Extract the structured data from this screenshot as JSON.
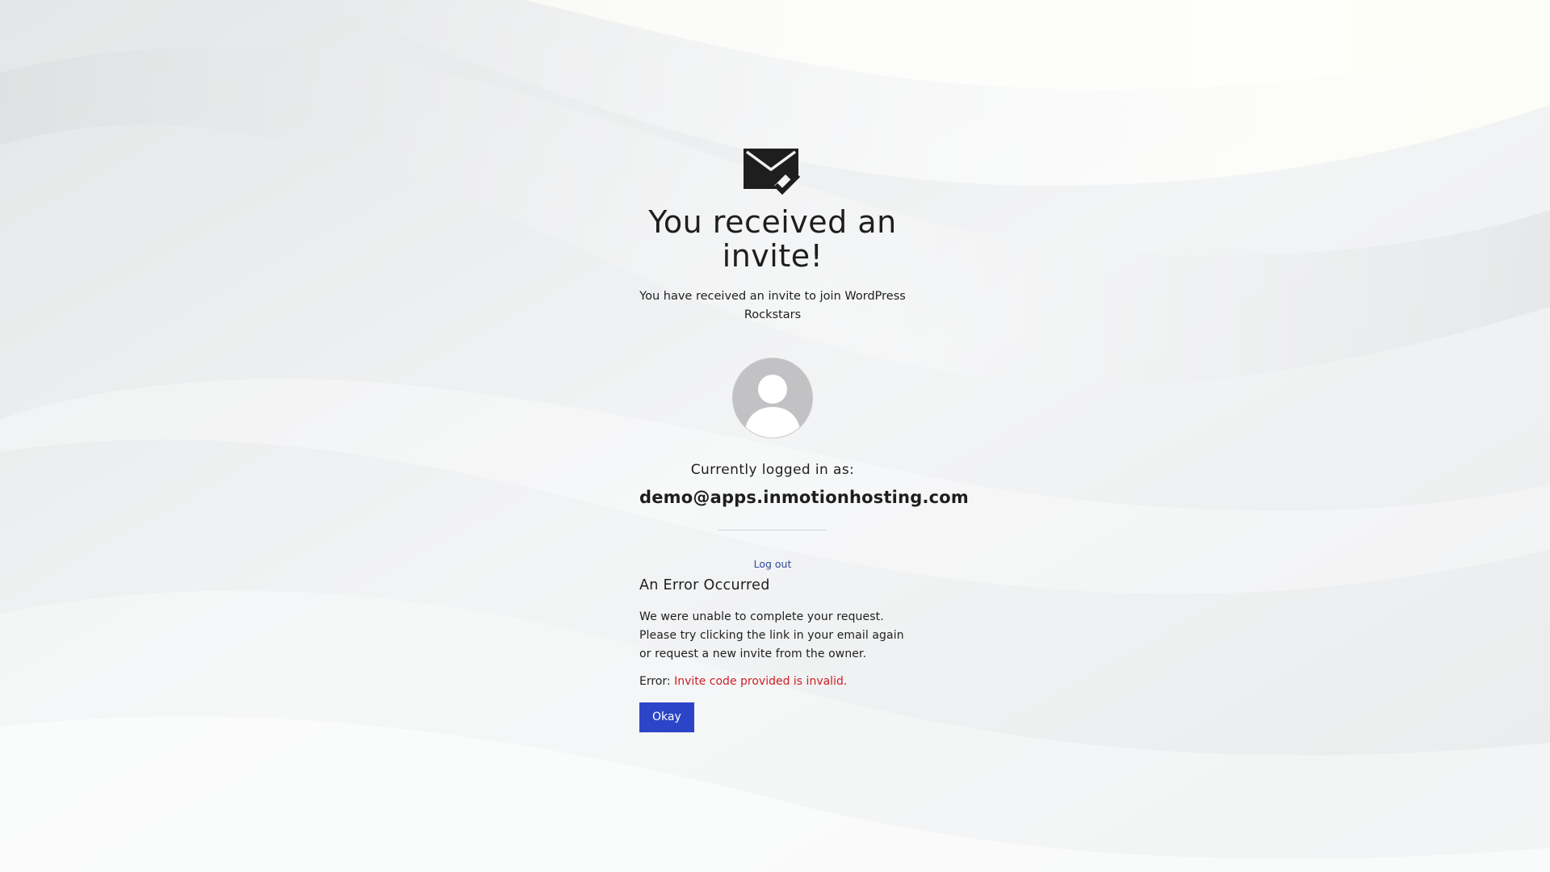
{
  "colors": {
    "background": "#eef0f1",
    "text": "#1e1e1e",
    "link": "#2d4a9a",
    "error": "#cc1f27",
    "button": "#2c45c8"
  },
  "header": {
    "icon": "envelope-check-icon",
    "title": "You received an invite!",
    "subtitle": "You have received an invite to join WordPress Rockstars"
  },
  "user": {
    "avatar_icon": "default-user-avatar",
    "logged_in_label": "Currently logged in as:",
    "email": "demo@apps.inmotionhosting.com",
    "logout_label": "Log out"
  },
  "error": {
    "title": "An Error Occurred",
    "body": "We were unable to complete your request. Please try clicking the link in your email again or request a new invite from the owner.",
    "prefix": "Error:",
    "message": "Invite code provided is invalid.",
    "button_label": "Okay"
  }
}
